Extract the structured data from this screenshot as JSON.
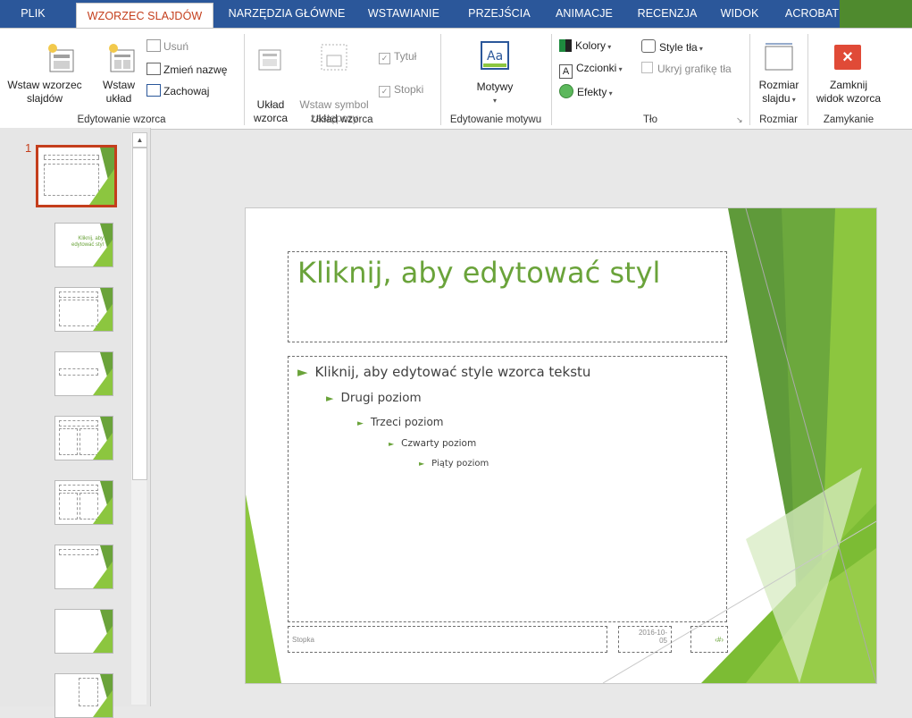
{
  "tabs": [
    {
      "label": "PLIK"
    },
    {
      "label": "WZORZEC SLAJDÓW"
    },
    {
      "label": "NARZĘDZIA GŁÓWNE"
    },
    {
      "label": "WSTAWIANIE"
    },
    {
      "label": "PRZEJŚCIA"
    },
    {
      "label": "ANIMACJE"
    },
    {
      "label": "RECENZJA"
    },
    {
      "label": "WIDOK"
    },
    {
      "label": "ACROBAT"
    }
  ],
  "ribbon": {
    "edit_master": {
      "insert_master_line1": "Wstaw wzorzec",
      "insert_master_line2": "slajdów",
      "insert_layout_line1": "Wstaw",
      "insert_layout_line2": "układ",
      "delete": "Usuń",
      "rename": "Zmień nazwę",
      "preserve": "Zachowaj",
      "group_label": "Edytowanie wzorca"
    },
    "master_layout": {
      "layout_line1": "Układ",
      "layout_line2": "wzorca",
      "placeholder_line1": "Wstaw symbol",
      "placeholder_line2": "zastępczy",
      "title_check": "Tytuł",
      "footers_check": "Stopki",
      "group_label": "Układ wzorca"
    },
    "edit_theme": {
      "themes": "Motywy",
      "group_label": "Edytowanie motywu"
    },
    "background": {
      "colors": "Kolory",
      "fonts": "Czcionki",
      "effects": "Efekty",
      "bg_styles": "Style tła",
      "hide_bg": "Ukryj grafikę tła",
      "group_label": "Tło"
    },
    "size": {
      "slide_size_line1": "Rozmiar",
      "slide_size_line2": "slajdu",
      "group_label": "Rozmiar"
    },
    "close": {
      "close_line1": "Zamknij",
      "close_line2": "widok wzorca",
      "group_label": "Zamykanie"
    }
  },
  "thumbnails": {
    "selected_number": "1",
    "mini_title_2": "Kliknij, aby",
    "mini_title_2b": "edytować styl"
  },
  "slide": {
    "title": "Kliknij, aby edytować styl",
    "level1": "Kliknij, aby edytować style wzorca tekstu",
    "level2": "Drugi poziom",
    "level3": "Trzeci poziom",
    "level4": "Czwarty poziom",
    "level5": "Piąty poziom",
    "footer": "Stopka",
    "date": "2016-10-05",
    "page_num": "‹#›"
  },
  "colors": {
    "ribbon_blue": "#2b579a",
    "active_tab_text": "#c43e1c",
    "theme_green": "#6aa33a",
    "theme_light_green": "#8cc63f",
    "close_red": "#e04a37"
  }
}
